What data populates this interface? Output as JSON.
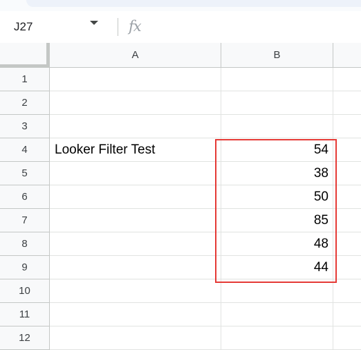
{
  "formula_bar": {
    "name_box": "J27",
    "fx_label": "fx",
    "formula": ""
  },
  "columns": [
    "A",
    "B"
  ],
  "rows": [
    {
      "num": "1",
      "a": "",
      "b": ""
    },
    {
      "num": "2",
      "a": "",
      "b": ""
    },
    {
      "num": "3",
      "a": "",
      "b": ""
    },
    {
      "num": "4",
      "a": "Looker Filter Test",
      "b": "54"
    },
    {
      "num": "5",
      "a": "",
      "b": "38"
    },
    {
      "num": "6",
      "a": "",
      "b": "50"
    },
    {
      "num": "7",
      "a": "",
      "b": "85"
    },
    {
      "num": "8",
      "a": "",
      "b": "48"
    },
    {
      "num": "9",
      "a": "",
      "b": "44"
    },
    {
      "num": "10",
      "a": "",
      "b": ""
    },
    {
      "num": "11",
      "a": "",
      "b": ""
    },
    {
      "num": "12",
      "a": "",
      "b": ""
    }
  ],
  "colors": {
    "highlight_border": "#e53935",
    "header_bg": "#f8f9fa",
    "gridline": "#e1e3e1"
  }
}
